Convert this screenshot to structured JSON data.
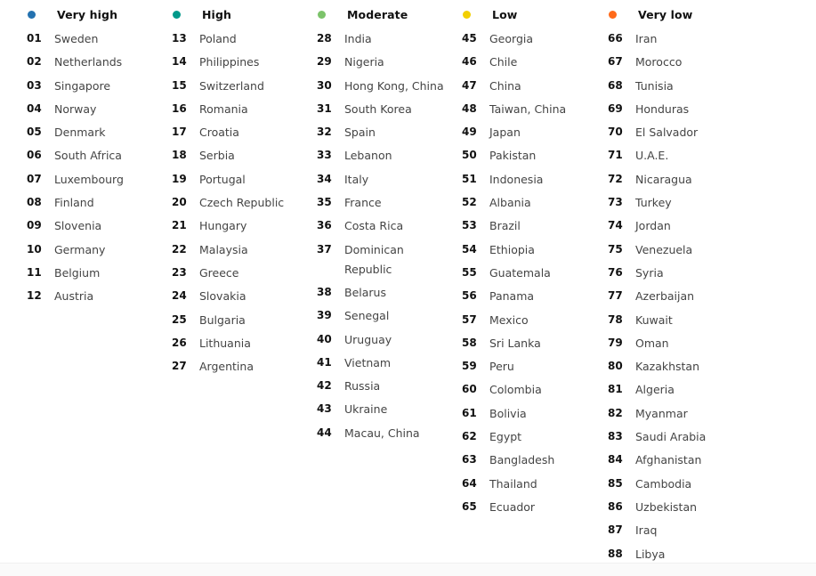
{
  "groups": [
    {
      "label": "Very high",
      "color": "#2472b0",
      "items": [
        {
          "rank": "01",
          "name": "Sweden"
        },
        {
          "rank": "02",
          "name": "Netherlands"
        },
        {
          "rank": "03",
          "name": "Singapore"
        },
        {
          "rank": "04",
          "name": "Norway"
        },
        {
          "rank": "05",
          "name": "Denmark"
        },
        {
          "rank": "06",
          "name": "South Africa"
        },
        {
          "rank": "07",
          "name": "Luxembourg"
        },
        {
          "rank": "08",
          "name": "Finland"
        },
        {
          "rank": "09",
          "name": "Slovenia"
        },
        {
          "rank": "10",
          "name": "Germany"
        },
        {
          "rank": "11",
          "name": "Belgium"
        },
        {
          "rank": "12",
          "name": "Austria"
        }
      ]
    },
    {
      "label": "High",
      "color": "#00998a",
      "items": [
        {
          "rank": "13",
          "name": "Poland"
        },
        {
          "rank": "14",
          "name": "Philippines"
        },
        {
          "rank": "15",
          "name": "Switzerland"
        },
        {
          "rank": "16",
          "name": "Romania"
        },
        {
          "rank": "17",
          "name": "Croatia"
        },
        {
          "rank": "18",
          "name": "Serbia"
        },
        {
          "rank": "19",
          "name": "Portugal"
        },
        {
          "rank": "20",
          "name": "Czech Republic"
        },
        {
          "rank": "21",
          "name": "Hungary"
        },
        {
          "rank": "22",
          "name": "Malaysia"
        },
        {
          "rank": "23",
          "name": "Greece"
        },
        {
          "rank": "24",
          "name": "Slovakia"
        },
        {
          "rank": "25",
          "name": "Bulgaria"
        },
        {
          "rank": "26",
          "name": "Lithuania"
        },
        {
          "rank": "27",
          "name": "Argentina"
        }
      ]
    },
    {
      "label": "Moderate",
      "color": "#7cc36a",
      "items": [
        {
          "rank": "28",
          "name": "India"
        },
        {
          "rank": "29",
          "name": "Nigeria"
        },
        {
          "rank": "30",
          "name": "Hong Kong, China"
        },
        {
          "rank": "31",
          "name": "South Korea"
        },
        {
          "rank": "32",
          "name": "Spain"
        },
        {
          "rank": "33",
          "name": "Lebanon"
        },
        {
          "rank": "34",
          "name": "Italy"
        },
        {
          "rank": "35",
          "name": "France"
        },
        {
          "rank": "36",
          "name": "Costa Rica"
        },
        {
          "rank": "37",
          "name": "Dominican Republic"
        },
        {
          "rank": "38",
          "name": "Belarus"
        },
        {
          "rank": "39",
          "name": "Senegal"
        },
        {
          "rank": "40",
          "name": "Uruguay"
        },
        {
          "rank": "41",
          "name": "Vietnam"
        },
        {
          "rank": "42",
          "name": "Russia"
        },
        {
          "rank": "43",
          "name": "Ukraine"
        },
        {
          "rank": "44",
          "name": "Macau, China"
        }
      ]
    },
    {
      "label": "Low",
      "color": "#f2cf00",
      "items": [
        {
          "rank": "45",
          "name": "Georgia"
        },
        {
          "rank": "46",
          "name": "Chile"
        },
        {
          "rank": "47",
          "name": "China"
        },
        {
          "rank": "48",
          "name": "Taiwan, China"
        },
        {
          "rank": "49",
          "name": "Japan"
        },
        {
          "rank": "50",
          "name": "Pakistan"
        },
        {
          "rank": "51",
          "name": "Indonesia"
        },
        {
          "rank": "52",
          "name": "Albania"
        },
        {
          "rank": "53",
          "name": "Brazil"
        },
        {
          "rank": "54",
          "name": "Ethiopia"
        },
        {
          "rank": "55",
          "name": "Guatemala"
        },
        {
          "rank": "56",
          "name": "Panama"
        },
        {
          "rank": "57",
          "name": "Mexico"
        },
        {
          "rank": "58",
          "name": "Sri Lanka"
        },
        {
          "rank": "59",
          "name": "Peru"
        },
        {
          "rank": "60",
          "name": "Colombia"
        },
        {
          "rank": "61",
          "name": "Bolivia"
        },
        {
          "rank": "62",
          "name": "Egypt"
        },
        {
          "rank": "63",
          "name": "Bangladesh"
        },
        {
          "rank": "64",
          "name": "Thailand"
        },
        {
          "rank": "65",
          "name": "Ecuador"
        }
      ]
    },
    {
      "label": "Very low",
      "color": "#ff6a1a",
      "items": [
        {
          "rank": "66",
          "name": "Iran"
        },
        {
          "rank": "67",
          "name": "Morocco"
        },
        {
          "rank": "68",
          "name": "Tunisia"
        },
        {
          "rank": "69",
          "name": "Honduras"
        },
        {
          "rank": "70",
          "name": "El Salvador"
        },
        {
          "rank": "71",
          "name": "U.A.E."
        },
        {
          "rank": "72",
          "name": "Nicaragua"
        },
        {
          "rank": "73",
          "name": "Turkey"
        },
        {
          "rank": "74",
          "name": "Jordan"
        },
        {
          "rank": "75",
          "name": "Venezuela"
        },
        {
          "rank": "76",
          "name": "Syria"
        },
        {
          "rank": "77",
          "name": "Azerbaijan"
        },
        {
          "rank": "78",
          "name": "Kuwait"
        },
        {
          "rank": "79",
          "name": "Oman"
        },
        {
          "rank": "80",
          "name": "Kazakhstan"
        },
        {
          "rank": "81",
          "name": "Algeria"
        },
        {
          "rank": "82",
          "name": "Myanmar"
        },
        {
          "rank": "83",
          "name": "Saudi Arabia"
        },
        {
          "rank": "84",
          "name": "Afghanistan"
        },
        {
          "rank": "85",
          "name": "Cambodia"
        },
        {
          "rank": "86",
          "name": "Uzbekistan"
        },
        {
          "rank": "87",
          "name": "Iraq"
        },
        {
          "rank": "88",
          "name": "Libya"
        }
      ]
    }
  ]
}
